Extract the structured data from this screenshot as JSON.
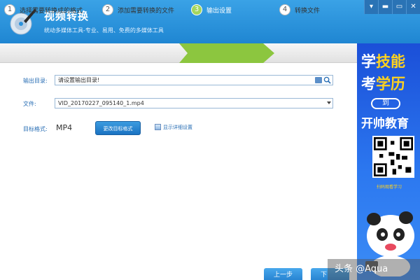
{
  "app": {
    "title": "视频转换",
    "subtitle": "统动多媒体工具-专业、易用、免费的多媒体工具"
  },
  "window_controls": [
    "▾",
    "▬",
    "▭",
    "✕"
  ],
  "steps": [
    {
      "num": "1",
      "label": "选择需要转换成的格式"
    },
    {
      "num": "2",
      "label": "添加需要转换的文件"
    },
    {
      "num": "3",
      "label": "输出设置"
    },
    {
      "num": "4",
      "label": "转换文件"
    }
  ],
  "active_step": 3,
  "form": {
    "output_dir_label": "输出目录:",
    "output_dir_value": "请设置输出目录!",
    "file_label": "文件:",
    "file_value": "VID_20170227_095140_1.mp4",
    "format_label": "目标格式:",
    "format_value": "MP4",
    "change_format_button": "更改目标格式",
    "show_details_label": "显示详细设置"
  },
  "ad": {
    "line1_a": "学",
    "line1_b": "技能",
    "line2_a": "考",
    "line2_b": "学历",
    "to": "到",
    "line3": "开帅教育",
    "qr_caption": "扫码观看学习"
  },
  "nav": {
    "prev_button": "上一步",
    "next_button": "下"
  },
  "watermark": "头条 @Aqua",
  "colors": {
    "titlebar": "#2a92dc",
    "step_active": "#8cc63f",
    "button": "#1f7acb"
  }
}
